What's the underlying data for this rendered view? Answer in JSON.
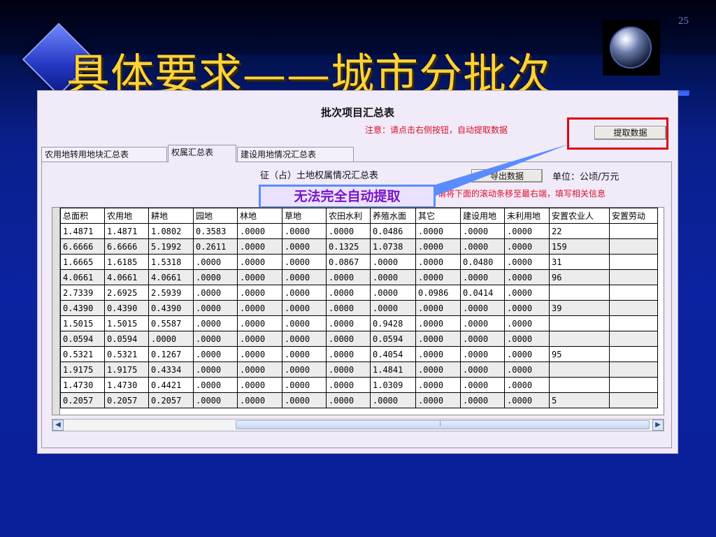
{
  "slide": {
    "title": "具体要求——城市分批次",
    "page_number": "25"
  },
  "form": {
    "title": "批次项目汇总表",
    "notice": "注意：请点击右侧按钮，自动提取数据",
    "extract_button": "提取数据",
    "tabs": [
      {
        "label": "农用地转用地块汇总表",
        "active": false
      },
      {
        "label": "权属汇总表",
        "active": true
      },
      {
        "label": "建设用地情况汇总表",
        "active": false
      }
    ],
    "subtitle": "征（占）土地权属情况汇总表",
    "export_button": "导出数据",
    "unit": "单位：公顷/万元",
    "hint": "请将下面的滚动条移至最右端，填写相关信息",
    "overlay_label": "无法完全自动提取"
  },
  "grid": {
    "columns": [
      "总面积",
      "农用地",
      "耕地",
      "园地",
      "林地",
      "草地",
      "农田水利",
      "养殖水面",
      "其它",
      "建设用地",
      "未利用地",
      "安置农业人",
      "安置劳动"
    ],
    "rows": [
      [
        "1.4871",
        "1.4871",
        "1.0802",
        "0.3583",
        ".0000",
        ".0000",
        ".0000",
        "0.0486",
        ".0000",
        ".0000",
        ".0000",
        "22",
        ""
      ],
      [
        "6.6666",
        "6.6666",
        "5.1992",
        "0.2611",
        ".0000",
        ".0000",
        "0.1325",
        "1.0738",
        ".0000",
        ".0000",
        ".0000",
        "159",
        ""
      ],
      [
        "1.6665",
        "1.6185",
        "1.5318",
        ".0000",
        ".0000",
        ".0000",
        "0.0867",
        ".0000",
        ".0000",
        "0.0480",
        ".0000",
        "31",
        ""
      ],
      [
        "4.0661",
        "4.0661",
        "4.0661",
        ".0000",
        ".0000",
        ".0000",
        ".0000",
        ".0000",
        ".0000",
        ".0000",
        ".0000",
        "96",
        ""
      ],
      [
        "2.7339",
        "2.6925",
        "2.5939",
        ".0000",
        ".0000",
        ".0000",
        ".0000",
        ".0000",
        "0.0986",
        "0.0414",
        ".0000",
        "",
        ""
      ],
      [
        "0.4390",
        "0.4390",
        "0.4390",
        ".0000",
        ".0000",
        ".0000",
        ".0000",
        ".0000",
        ".0000",
        ".0000",
        ".0000",
        "39",
        ""
      ],
      [
        "1.5015",
        "1.5015",
        "0.5587",
        ".0000",
        ".0000",
        ".0000",
        ".0000",
        "0.9428",
        ".0000",
        ".0000",
        ".0000",
        "",
        ""
      ],
      [
        "0.0594",
        "0.0594",
        ".0000",
        ".0000",
        ".0000",
        ".0000",
        ".0000",
        "0.0594",
        ".0000",
        ".0000",
        ".0000",
        "",
        ""
      ],
      [
        "0.5321",
        "0.5321",
        "0.1267",
        ".0000",
        ".0000",
        ".0000",
        ".0000",
        "0.4054",
        ".0000",
        ".0000",
        ".0000",
        "95",
        ""
      ],
      [
        "1.9175",
        "1.9175",
        "0.4334",
        ".0000",
        ".0000",
        ".0000",
        ".0000",
        "1.4841",
        ".0000",
        ".0000",
        ".0000",
        "",
        ""
      ],
      [
        "1.4730",
        "1.4730",
        "0.4421",
        ".0000",
        ".0000",
        ".0000",
        ".0000",
        "1.0309",
        ".0000",
        ".0000",
        ".0000",
        "",
        ""
      ],
      [
        "0.2057",
        "0.2057",
        "0.2057",
        ".0000",
        ".0000",
        ".0000",
        ".0000",
        ".0000",
        ".0000",
        ".0000",
        ".0000",
        "5",
        ""
      ]
    ]
  },
  "colors": {
    "title": "#ffd23a",
    "notice": "#d8102a",
    "highlight_box": "#e00012",
    "overlay_border": "#5a8cff",
    "overlay_text": "#7a14c8"
  },
  "icons": {
    "scroll_left": "◀",
    "scroll_right": "▶",
    "thumb_grip": "⁞"
  }
}
